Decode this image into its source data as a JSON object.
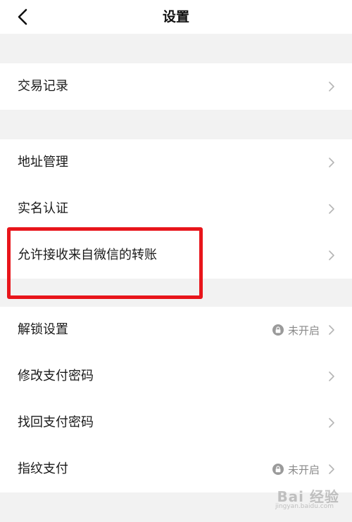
{
  "header": {
    "title": "设置",
    "back_icon": "chevron-left-icon"
  },
  "rows": {
    "transactions": {
      "label": "交易记录"
    },
    "address": {
      "label": "地址管理"
    },
    "realname": {
      "label": "实名认证"
    },
    "wechat_transfer": {
      "label": "允许接收来自微信的转账"
    },
    "unlock": {
      "label": "解锁设置",
      "status": "未开启"
    },
    "change_password": {
      "label": "修改支付密码"
    },
    "recover_password": {
      "label": "找回支付密码"
    },
    "fingerprint": {
      "label": "指纹支付",
      "status": "未开启"
    }
  },
  "watermark": {
    "brand": "Bai 经验",
    "sub": "jingyan.baidu.com"
  },
  "colors": {
    "highlight": "#e8151b",
    "separator": "#f2f2f2",
    "secondary_text": "#8a8a8a"
  }
}
